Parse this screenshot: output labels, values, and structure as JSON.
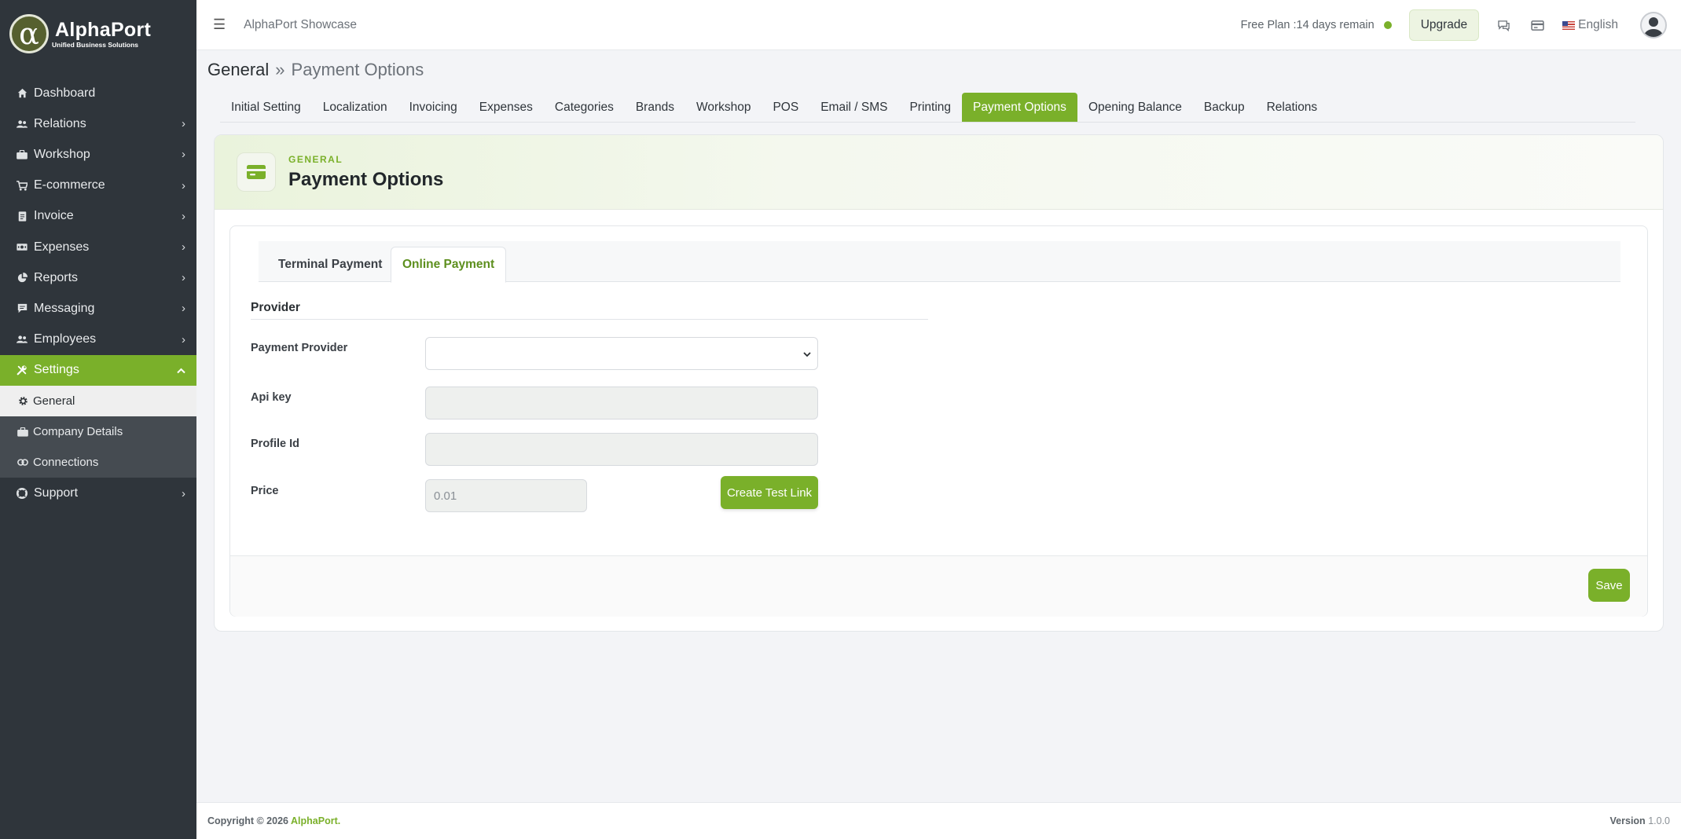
{
  "brand": {
    "name": "AlphaPort",
    "tagline": "Unified Business Solutions",
    "symbol": "α"
  },
  "sidebar": {
    "items": [
      {
        "label": "Dashboard",
        "icon": "home-icon"
      },
      {
        "label": "Relations",
        "icon": "users-icon"
      },
      {
        "label": "Workshop",
        "icon": "briefcase-icon"
      },
      {
        "label": "E-commerce",
        "icon": "cart-icon"
      },
      {
        "label": "Invoice",
        "icon": "document-icon"
      },
      {
        "label": "Expenses",
        "icon": "money-icon"
      },
      {
        "label": "Reports",
        "icon": "pie-chart-icon"
      },
      {
        "label": "Messaging",
        "icon": "chat-icon"
      },
      {
        "label": "Employees",
        "icon": "users-icon"
      },
      {
        "label": "Settings",
        "icon": "tools-icon"
      }
    ],
    "settings_children": [
      {
        "label": "General",
        "icon": "gear-icon"
      },
      {
        "label": "Company Details",
        "icon": "briefcase-icon"
      },
      {
        "label": "Connections",
        "icon": "link-icon"
      }
    ],
    "support": {
      "label": "Support",
      "icon": "lifebuoy-icon"
    }
  },
  "topbar": {
    "company": "AlphaPort Showcase",
    "plan": "Free Plan :14 days remain",
    "upgrade": "Upgrade",
    "language": "English"
  },
  "breadcrumb": {
    "section": "General",
    "separator": "»",
    "current": "Payment Options"
  },
  "tabs": [
    "Initial Setting",
    "Localization",
    "Invoicing",
    "Expenses",
    "Categories",
    "Brands",
    "Workshop",
    "POS",
    "Email / SMS",
    "Printing",
    "Payment Options",
    "Opening Balance",
    "Backup",
    "Relations"
  ],
  "active_tab": "Payment Options",
  "card": {
    "eyebrow": "GENERAL",
    "title": "Payment Options"
  },
  "subtabs": {
    "terminal": "Terminal Payment",
    "online": "Online Payment",
    "active": "Online Payment"
  },
  "form": {
    "section": "Provider",
    "payment_provider_label": "Payment Provider",
    "payment_provider_value": "",
    "api_key_label": "Api key",
    "api_key_value": "",
    "profile_id_label": "Profile Id",
    "profile_id_value": "",
    "price_label": "Price",
    "price_value": "0.01",
    "create_test_link": "Create Test Link",
    "save": "Save"
  },
  "footer": {
    "copyright": "Copyright © 2026",
    "brand": "AlphaPort.",
    "version_label": "Version",
    "version": "1.0.0"
  },
  "colors": {
    "accent": "#7ab02a",
    "sidebar": "#2f353b"
  }
}
